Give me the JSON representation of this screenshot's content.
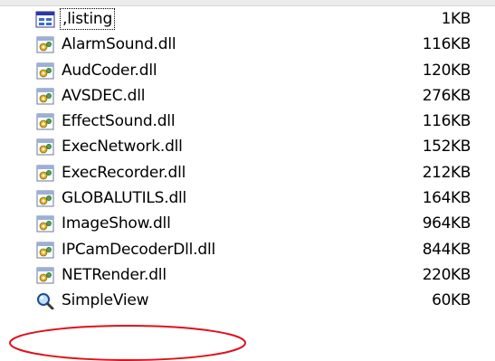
{
  "files": [
    {
      "name": ",listing",
      "size": "1KB",
      "icon": "listing-file-icon"
    },
    {
      "name": "AlarmSound.dll",
      "size": "116KB",
      "icon": "dll-file-icon"
    },
    {
      "name": "AudCoder.dll",
      "size": "120KB",
      "icon": "dll-file-icon"
    },
    {
      "name": "AVSDEC.dll",
      "size": "276KB",
      "icon": "dll-file-icon"
    },
    {
      "name": "EffectSound.dll",
      "size": "116KB",
      "icon": "dll-file-icon"
    },
    {
      "name": "ExecNetwork.dll",
      "size": "152KB",
      "icon": "dll-file-icon"
    },
    {
      "name": "ExecRecorder.dll",
      "size": "212KB",
      "icon": "dll-file-icon"
    },
    {
      "name": "GLOBALUTILS.dll",
      "size": "164KB",
      "icon": "dll-file-icon"
    },
    {
      "name": "ImageShow.dll",
      "size": "964KB",
      "icon": "dll-file-icon"
    },
    {
      "name": "IPCamDecoderDll.dll",
      "size": "844KB",
      "icon": "dll-file-icon"
    },
    {
      "name": "NETRender.dll",
      "size": "220KB",
      "icon": "dll-file-icon"
    },
    {
      "name": "SimpleView",
      "size": "60KB",
      "icon": "simpleview-app-icon"
    }
  ],
  "colors": {
    "highlight_oval": "#e0101a",
    "text": "#000000",
    "background": "#ffffff"
  }
}
